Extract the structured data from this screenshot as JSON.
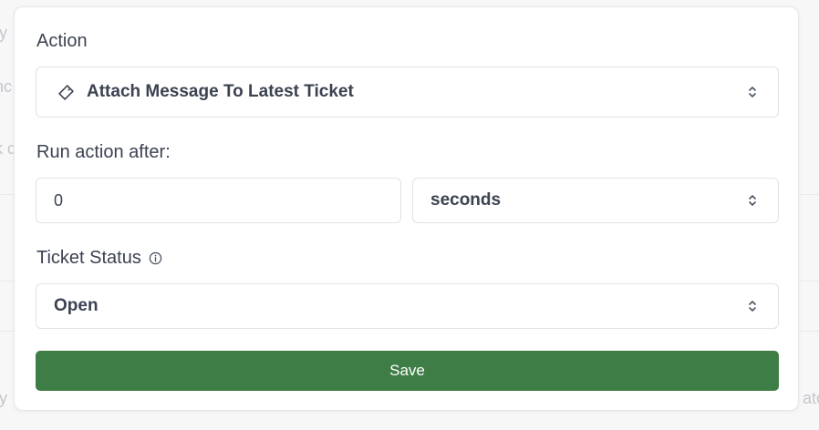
{
  "background": {
    "left_fragments": [
      "fy",
      "nc",
      "k d",
      "fy"
    ],
    "right_fragments": [
      "atc"
    ]
  },
  "form": {
    "action_label": "Action",
    "action_value": "Attach Message To Latest Ticket",
    "action_icon": "ticket-icon",
    "run_after_label": "Run action after:",
    "run_after_value": "0",
    "run_after_unit": "seconds",
    "ticket_status_label": "Ticket Status",
    "ticket_status_info_icon": "info-icon",
    "ticket_status_value": "Open",
    "save_label": "Save"
  },
  "colors": {
    "accent": "#3f7d46",
    "text": "#3b4250",
    "border": "#dfe2e6"
  }
}
